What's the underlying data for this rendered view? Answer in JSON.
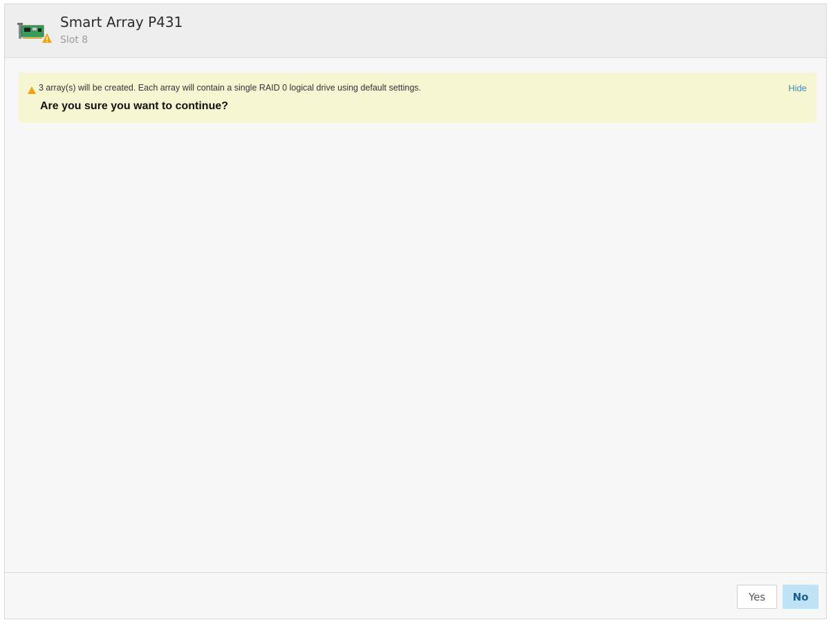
{
  "header": {
    "title": "Smart Array P431",
    "subtitle": "Slot 8"
  },
  "alert": {
    "message": "3 array(s) will be created. Each array will contain a single RAID 0 logical drive using default settings.",
    "question": "Are you sure you want to continue?",
    "hide_label": "Hide",
    "icon": "warning-triangle-icon"
  },
  "footer": {
    "yes_label": "Yes",
    "no_label": "No"
  },
  "colors": {
    "alert_background": "#f6f6d2",
    "warning": "#f0a30a",
    "link": "#2f8fd0",
    "primary_button": "#bfe2f4"
  }
}
